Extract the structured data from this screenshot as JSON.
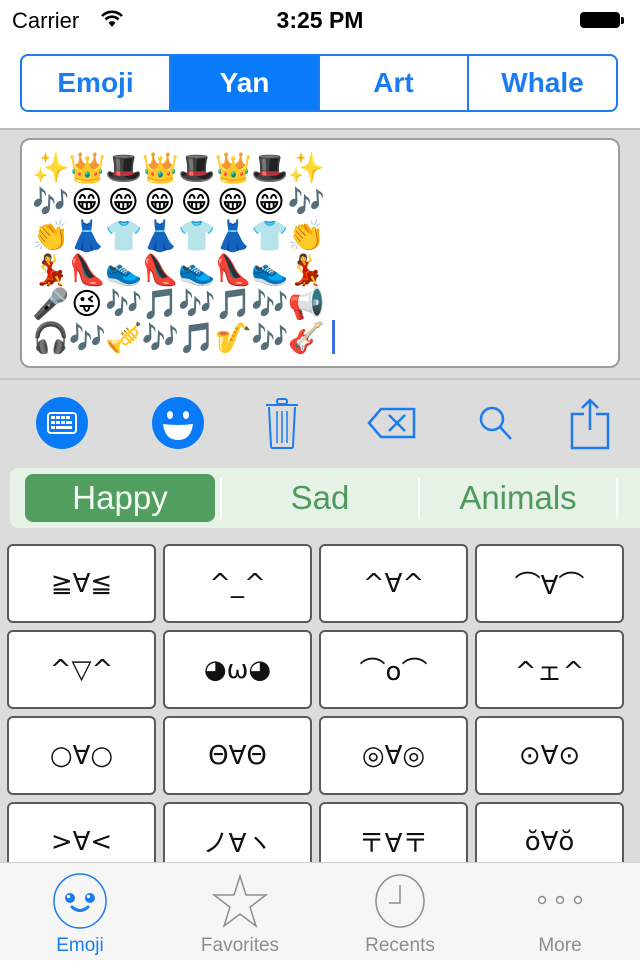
{
  "status_bar": {
    "carrier": "Carrier",
    "time": "3:25 PM",
    "wifi_icon": "wifi-icon",
    "battery_icon": "battery-full-icon"
  },
  "top_segments": {
    "items": [
      {
        "label": "Emoji",
        "active": false
      },
      {
        "label": "Yan",
        "active": true
      },
      {
        "label": "Art",
        "active": false
      },
      {
        "label": "Whale",
        "active": false
      }
    ],
    "accent_color": "#0a7bf8"
  },
  "text_area": {
    "rows": [
      [
        "✨",
        "👑",
        "🎩",
        "👑",
        "🎩",
        "👑",
        "🎩",
        "✨"
      ],
      [
        "🎶",
        "😁",
        "😁",
        "😁",
        "😁",
        "😁",
        "😁",
        "🎶"
      ],
      [
        "👏",
        "👗",
        "👕",
        "👗",
        "👕",
        "👗",
        "👕",
        "👏"
      ],
      [
        "💃",
        "👠",
        "👟",
        "👠",
        "👟",
        "👠",
        "👟",
        "💃"
      ],
      [
        "🎤",
        "😜",
        "🎶",
        "🎵",
        "🎶",
        "🎵",
        "🎶",
        "📢"
      ],
      [
        "🎧",
        "🎶",
        "🎺",
        "🎶",
        "🎵",
        "🎷",
        "🎶",
        "🎸"
      ]
    ]
  },
  "toolbar": {
    "keyboard_icon": "keyboard-icon",
    "emoji_icon": "smiley-icon",
    "trash_icon": "trash-icon",
    "delete_icon": "backspace-icon",
    "search_icon": "search-icon",
    "share_icon": "share-icon"
  },
  "categories": {
    "items": [
      {
        "label": "Happy",
        "active": true
      },
      {
        "label": "Sad",
        "active": false
      },
      {
        "label": "Animals",
        "active": false
      }
    ],
    "accent_color": "#529e60"
  },
  "kaomoji": [
    "≧∀≦",
    "^_^",
    "^∀^",
    "⌒∀⌒",
    "^▽^",
    "◕ω◕",
    "⌒o⌒",
    "^ェ^",
    "○∀○",
    "Θ∀Θ",
    "◎∀◎",
    "⊙∀⊙",
    ">∀<",
    "ノ∀ヽ",
    "〒∀〒",
    "ŏ∀ŏ"
  ],
  "tab_bar": {
    "items": [
      {
        "label": "Emoji",
        "icon": "emoji-face-icon",
        "active": true
      },
      {
        "label": "Favorites",
        "icon": "star-icon",
        "active": false
      },
      {
        "label": "Recents",
        "icon": "clock-icon",
        "active": false
      },
      {
        "label": "More",
        "icon": "more-dots-icon",
        "active": false
      }
    ]
  }
}
